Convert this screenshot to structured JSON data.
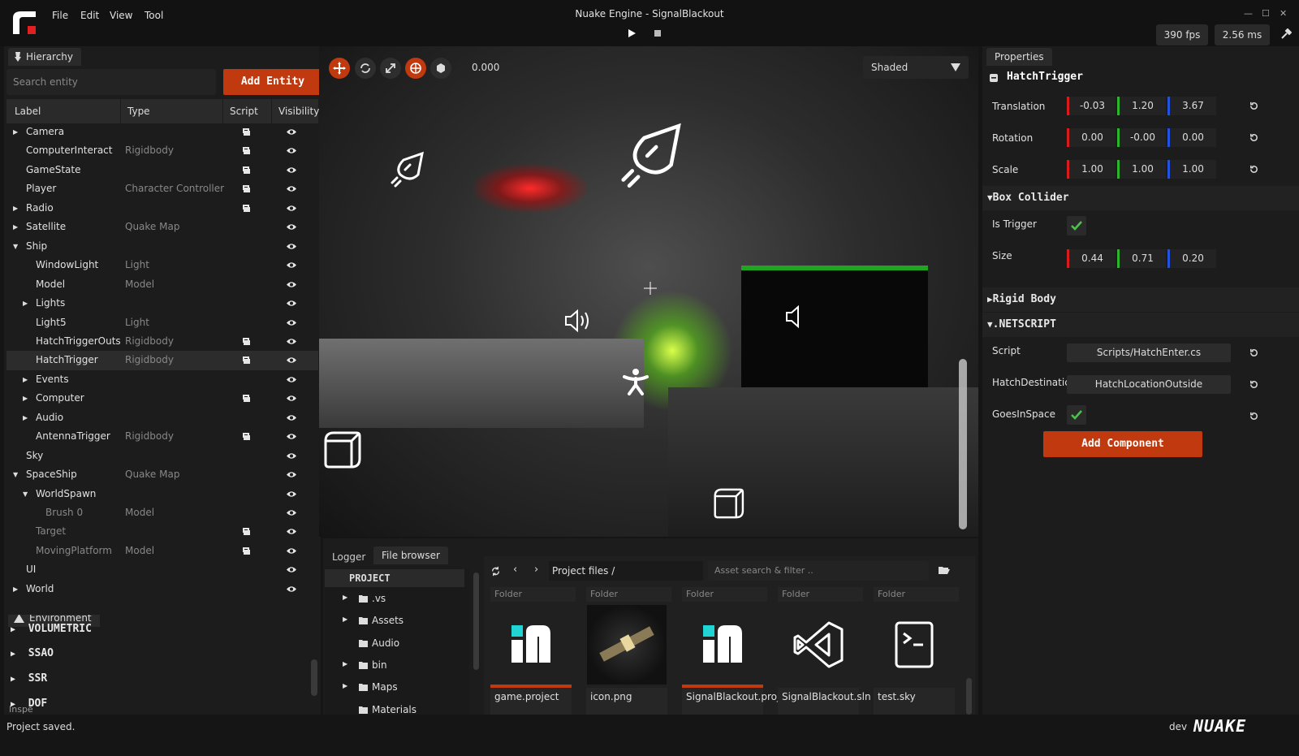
{
  "window": {
    "title": "Nuake Engine - SignalBlackout",
    "fps": "390 fps",
    "frame_time": "2.56 ms"
  },
  "menu": [
    "File",
    "Edit",
    "View",
    "Tool"
  ],
  "hierarchy": {
    "tab": "Hierarchy",
    "search_placeholder": "Search entity",
    "add_button": "Add Entity",
    "columns": {
      "label": "Label",
      "type": "Type",
      "script": "Script",
      "visibility": "Visibility"
    },
    "rows": [
      {
        "label": "Camera",
        "type": "",
        "depth": 0,
        "expand": "closed",
        "script": true
      },
      {
        "label": "ComputerInteract",
        "type": "Rigidbody",
        "depth": 0,
        "expand": "none",
        "script": true
      },
      {
        "label": "GameState",
        "type": "",
        "depth": 0,
        "expand": "none",
        "script": true
      },
      {
        "label": "Player",
        "type": "Character Controller",
        "depth": 0,
        "expand": "none",
        "script": true
      },
      {
        "label": "Radio",
        "type": "",
        "depth": 0,
        "expand": "closed",
        "script": true
      },
      {
        "label": "Satellite",
        "type": "Quake Map",
        "depth": 0,
        "expand": "closed",
        "script": false
      },
      {
        "label": "Ship",
        "type": "",
        "depth": 0,
        "expand": "open",
        "script": false
      },
      {
        "label": "WindowLight",
        "type": "Light",
        "depth": 1,
        "expand": "none",
        "script": false
      },
      {
        "label": "Model",
        "type": "Model",
        "depth": 1,
        "expand": "none",
        "script": false
      },
      {
        "label": "Lights",
        "type": "",
        "depth": 1,
        "expand": "closed",
        "script": false
      },
      {
        "label": "Light5",
        "type": "Light",
        "depth": 1,
        "expand": "none",
        "script": false
      },
      {
        "label": "HatchTriggerOuts",
        "type": "Rigidbody",
        "depth": 1,
        "expand": "none",
        "script": true
      },
      {
        "label": "HatchTrigger",
        "type": "Rigidbody",
        "depth": 1,
        "expand": "none",
        "script": true,
        "selected": true
      },
      {
        "label": "Events",
        "type": "",
        "depth": 1,
        "expand": "closed",
        "script": false
      },
      {
        "label": "Computer",
        "type": "",
        "depth": 1,
        "expand": "closed",
        "script": true
      },
      {
        "label": "Audio",
        "type": "",
        "depth": 1,
        "expand": "closed",
        "script": false
      },
      {
        "label": "AntennaTrigger",
        "type": "Rigidbody",
        "depth": 1,
        "expand": "none",
        "script": true
      },
      {
        "label": "Sky",
        "type": "",
        "depth": 0,
        "expand": "none",
        "script": false
      },
      {
        "label": "SpaceShip",
        "type": "Quake Map",
        "depth": 0,
        "expand": "open",
        "script": false
      },
      {
        "label": "WorldSpawn",
        "type": "",
        "depth": 1,
        "expand": "open",
        "script": false
      },
      {
        "label": "Brush 0",
        "type": "Model",
        "depth": 2,
        "expand": "none",
        "script": false,
        "dim": true
      },
      {
        "label": "Target",
        "type": "",
        "depth": 1,
        "expand": "none",
        "script": true,
        "dim": true
      },
      {
        "label": "MovingPlatform",
        "type": "Model",
        "depth": 1,
        "expand": "none",
        "script": true,
        "dim": true
      },
      {
        "label": "UI",
        "type": "",
        "depth": 0,
        "expand": "none",
        "script": false
      },
      {
        "label": "World",
        "type": "",
        "depth": 0,
        "expand": "closed",
        "script": false
      }
    ]
  },
  "environment": {
    "tab": "Environment",
    "items": [
      "VOLUMETRIC",
      "SSAO",
      "SSR",
      "DOF"
    ],
    "overlap_tab": "Inspe"
  },
  "viewport": {
    "time": "0.000",
    "shading": "Shaded"
  },
  "properties": {
    "tab": "Properties",
    "entity_name": "HatchTrigger",
    "transform": [
      {
        "label": "Translation",
        "x": "-0.03",
        "y": "1.20",
        "z": "3.67"
      },
      {
        "label": "Rotation",
        "x": "0.00",
        "y": "-0.00",
        "z": "0.00"
      },
      {
        "label": "Scale",
        "x": "1.00",
        "y": "1.00",
        "z": "1.00"
      }
    ],
    "box_collider": {
      "title": "Box Collider",
      "is_trigger_label": "Is Trigger",
      "is_trigger": true,
      "size_label": "Size",
      "size": {
        "x": "0.44",
        "y": "0.71",
        "z": "0.20"
      }
    },
    "rigid_body": {
      "title": "Rigid Body"
    },
    "netscript": {
      "title": ".NETSCRIPT",
      "script_label": "Script",
      "script_value": "Scripts/HatchEnter.cs",
      "dest_label": "HatchDestinatic",
      "dest_value": "HatchLocationOutside",
      "space_label": "GoesInSpace",
      "space_value": true
    },
    "add_component": "Add Component"
  },
  "bottom": {
    "tabs": [
      "Logger",
      "File browser"
    ],
    "tree_root": "PROJECT",
    "tree": [
      {
        "name": ".vs",
        "expand": true
      },
      {
        "name": "Assets",
        "expand": true
      },
      {
        "name": "Audio",
        "expand": false
      },
      {
        "name": "bin",
        "expand": true
      },
      {
        "name": "Maps",
        "expand": true
      },
      {
        "name": "Materials",
        "expand": false
      }
    ],
    "path_label": "Project files",
    "path_sep": "/",
    "search_placeholder": "Asset search & filter ..",
    "files": [
      {
        "head": "Folder",
        "name": "game.project",
        "icon": "nuake-logo-icon"
      },
      {
        "head": "Folder",
        "name": "icon.png",
        "icon": "satellite-image"
      },
      {
        "head": "Folder",
        "name": "SignalBlackout.project",
        "icon": "nuake-logo-icon"
      },
      {
        "head": "Folder",
        "name": "SignalBlackout.sln",
        "icon": "visual-studio-icon"
      },
      {
        "head": "Folder",
        "name": "test.sky",
        "icon": "script-file-icon"
      }
    ]
  },
  "status": {
    "message": "Project saved.",
    "build": "dev",
    "brand": "NUAKE"
  },
  "colors": {
    "accent": "#c0390f",
    "x_axis": "#d81b1b",
    "y_axis": "#2bb52b",
    "z_axis": "#2253e0",
    "check": "#4cc24c"
  }
}
